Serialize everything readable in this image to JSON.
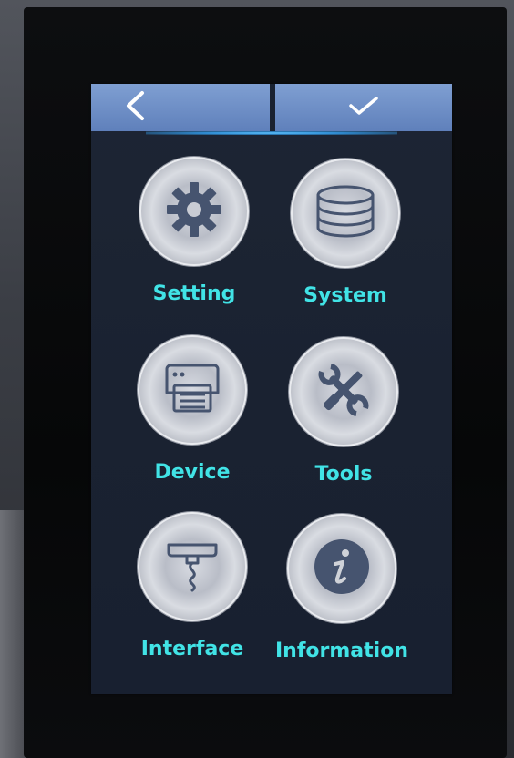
{
  "topbar": {
    "back_icon": "chevron-left-icon",
    "confirm_icon": "check-icon",
    "color": "#6b8cc6"
  },
  "menu": {
    "label_color": "#41e3e6",
    "items": [
      {
        "label": "Setting",
        "icon": "gear-icon"
      },
      {
        "label": "System",
        "icon": "database-icon"
      },
      {
        "label": "Device",
        "icon": "printer-icon"
      },
      {
        "label": "Tools",
        "icon": "wrench-screwdriver-icon"
      },
      {
        "label": "Interface",
        "icon": "usb-cable-icon"
      },
      {
        "label": "Information",
        "icon": "info-icon"
      }
    ]
  }
}
